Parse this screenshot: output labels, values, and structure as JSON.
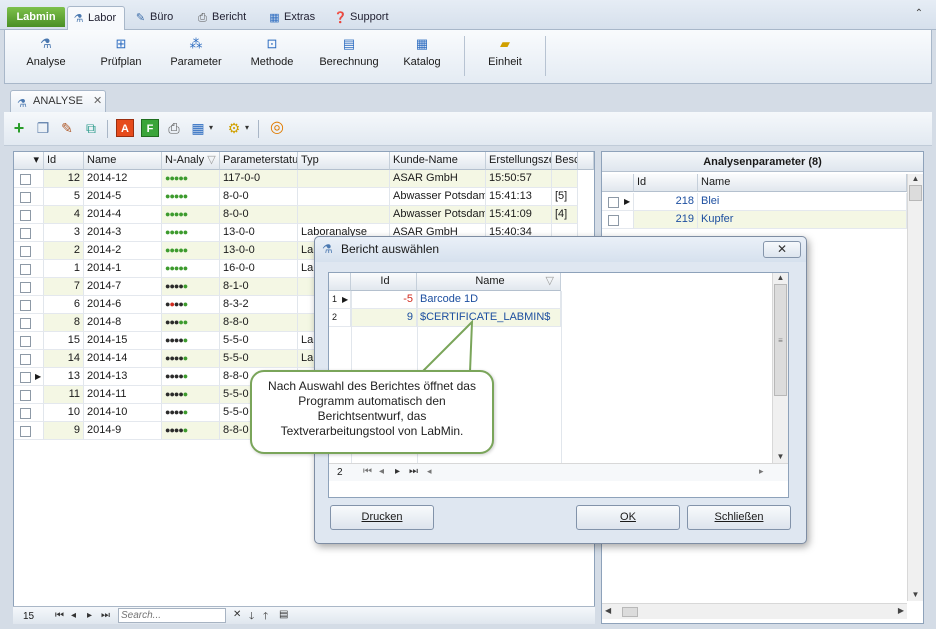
{
  "app_tab": "Labmin",
  "ribbon_tabs": [
    {
      "label": "Labor",
      "icon": "flask-icon"
    },
    {
      "label": "Büro",
      "icon": "pen-icon"
    },
    {
      "label": "Bericht",
      "icon": "printer-icon"
    },
    {
      "label": "Extras",
      "icon": "table-icon"
    },
    {
      "label": "Support",
      "icon": "help-icon"
    }
  ],
  "ribbon_buttons": [
    {
      "label": "Analyse",
      "icon": "flask-icon"
    },
    {
      "label": "Prüfplan",
      "icon": "tree-icon"
    },
    {
      "label": "Parameter",
      "icon": "molecule-icon"
    },
    {
      "label": "Methode",
      "icon": "method-icon"
    },
    {
      "label": "Berechnung",
      "icon": "calculator-icon"
    },
    {
      "label": "Katalog",
      "icon": "catalog-icon"
    },
    {
      "label": "Einheit",
      "icon": "ruler-icon"
    }
  ],
  "doc_tab": "ANALYSE",
  "grid": {
    "columns": [
      "Id",
      "Name",
      "N-Analy",
      "Parameterstatu",
      "Typ",
      "Kunde-Name",
      "Erstellungsze",
      "Besc"
    ],
    "rows": [
      {
        "id": "12",
        "name": "2014-12",
        "dots": "ggggg",
        "param": "117-0-0",
        "typ": "",
        "kunde": "ASAR GmbH",
        "zeit": "15:50:57",
        "besc": ""
      },
      {
        "id": "5",
        "name": "2014-5",
        "dots": "ggggg",
        "param": "8-0-0",
        "typ": "",
        "kunde": "Abwasser Potsdam",
        "zeit": "15:41:13",
        "besc": "[5]"
      },
      {
        "id": "4",
        "name": "2014-4",
        "dots": "ggggg",
        "param": "8-0-0",
        "typ": "",
        "kunde": "Abwasser Potsdam",
        "zeit": "15:41:09",
        "besc": "[4]"
      },
      {
        "id": "3",
        "name": "2014-3",
        "dots": "ggggg",
        "param": "13-0-0",
        "typ": "Laboranalyse",
        "kunde": "ASAR GmbH",
        "zeit": "15:40:34",
        "besc": ""
      },
      {
        "id": "2",
        "name": "2014-2",
        "dots": "ggggg",
        "param": "13-0-0",
        "typ": "Lab",
        "kunde": "",
        "zeit": "",
        "besc": ""
      },
      {
        "id": "1",
        "name": "2014-1",
        "dots": "ggggg",
        "param": "16-0-0",
        "typ": "Lab",
        "kunde": "",
        "zeit": "",
        "besc": ""
      },
      {
        "id": "7",
        "name": "2014-7",
        "dots": "kkkkg",
        "param": "8-1-0",
        "typ": "",
        "kunde": "",
        "zeit": "",
        "besc": ""
      },
      {
        "id": "6",
        "name": "2014-6",
        "dots": "krkkg",
        "param": "8-3-2",
        "typ": "",
        "kunde": "",
        "zeit": "",
        "besc": ""
      },
      {
        "id": "8",
        "name": "2014-8",
        "dots": "kkkgg",
        "param": "8-8-0",
        "typ": "",
        "kunde": "",
        "zeit": "",
        "besc": ""
      },
      {
        "id": "15",
        "name": "2014-15",
        "dots": "kkkkg",
        "param": "5-5-0",
        "typ": "Lab",
        "kunde": "",
        "zeit": "",
        "besc": ""
      },
      {
        "id": "14",
        "name": "2014-14",
        "dots": "kkkkg",
        "param": "5-5-0",
        "typ": "Lab",
        "kunde": "",
        "zeit": "",
        "besc": ""
      },
      {
        "id": "13",
        "name": "2014-13",
        "dots": "kkkkg",
        "param": "8-8-0",
        "typ": "",
        "kunde": "",
        "zeit": "",
        "besc": ""
      },
      {
        "id": "11",
        "name": "2014-11",
        "dots": "kkkkg",
        "param": "5-5-0",
        "typ": "",
        "kunde": "",
        "zeit": "",
        "besc": ""
      },
      {
        "id": "10",
        "name": "2014-10",
        "dots": "kkkkg",
        "param": "5-5-0",
        "typ": "",
        "kunde": "",
        "zeit": "",
        "besc": ""
      },
      {
        "id": "9",
        "name": "2014-9",
        "dots": "kkkkg",
        "param": "8-8-0",
        "typ": "",
        "kunde": "",
        "zeit": "",
        "besc": ""
      }
    ]
  },
  "statusbar": {
    "count": "15",
    "search_placeholder": "Search..."
  },
  "right_panel": {
    "title": "Analysenparameter (8)",
    "columns": [
      "Id",
      "Name"
    ],
    "rows": [
      {
        "id": "218",
        "name": "Blei"
      },
      {
        "id": "219",
        "name": "Kupfer"
      }
    ]
  },
  "dialog": {
    "title": "Bericht auswählen",
    "columns": [
      "Id",
      "Name"
    ],
    "rows": [
      {
        "n": "1",
        "id": "-5",
        "name": "Barcode 1D"
      },
      {
        "n": "2",
        "id": "9",
        "name": "$CERTIFICATE_LABMIN$"
      }
    ],
    "count": "2",
    "buttons": {
      "print": "Drucken",
      "ok": "OK",
      "close": "Schließen"
    }
  },
  "callout": "Nach Auswahl des Berichtes öffnet das Programm automatisch den Berichtsentwurf, das Textverarbeitungstool von LabMin.",
  "colors": {
    "accent": "#4a8f25",
    "row_band": "#f4f7e4",
    "selection": "#cfe0f5"
  }
}
